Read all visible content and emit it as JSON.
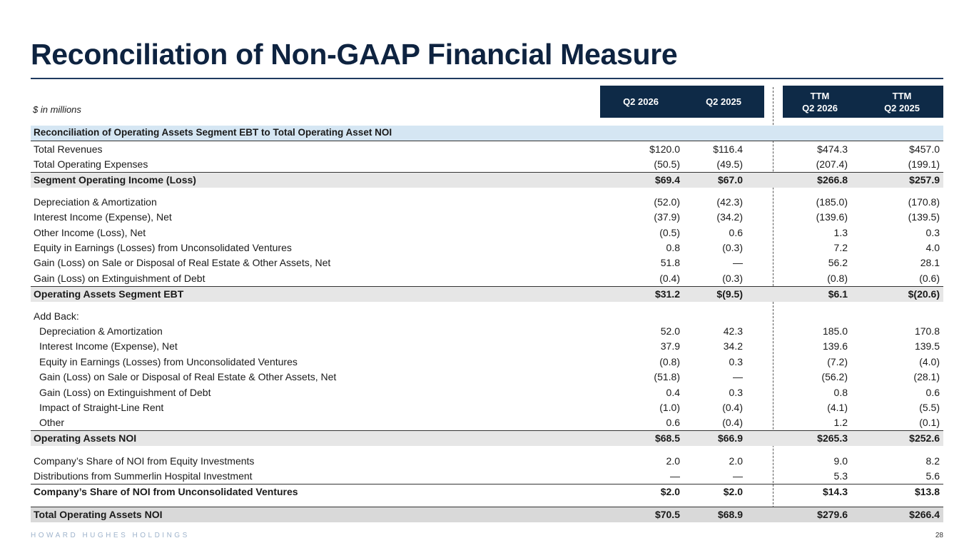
{
  "title": "Reconciliation of Non-GAAP Financial Measure",
  "units_note": "$ in millions",
  "columns": [
    {
      "line1": "Q2 2026",
      "line2": ""
    },
    {
      "line1": "Q2 2025",
      "line2": ""
    },
    {
      "line1": "TTM",
      "line2": "Q2 2026"
    },
    {
      "line1": "TTM",
      "line2": "Q2 2025"
    }
  ],
  "section_header": "Reconciliation of Operating Assets Segment EBT to Total Operating Asset NOI",
  "rows": [
    {
      "label": "Total Revenues",
      "values": [
        "$120.0",
        "$116.4",
        "$474.3",
        "$457.0"
      ]
    },
    {
      "label": "Total Operating Expenses",
      "values": [
        "(50.5)",
        "(49.5)",
        "(207.4)",
        "(199.1)"
      ]
    },
    {
      "label": "Segment Operating Income (Loss)",
      "values": [
        "$69.4",
        "$67.0",
        "$266.8",
        "$257.9"
      ]
    },
    {
      "label": "Depreciation & Amortization",
      "values": [
        "(52.0)",
        "(42.3)",
        "(185.0)",
        "(170.8)"
      ]
    },
    {
      "label": "Interest Income (Expense), Net",
      "values": [
        "(37.9)",
        "(34.2)",
        "(139.6)",
        "(139.5)"
      ]
    },
    {
      "label": "Other Income (Loss), Net",
      "values": [
        "(0.5)",
        "0.6",
        "1.3",
        "0.3"
      ]
    },
    {
      "label": "Equity in Earnings (Losses) from Unconsolidated Ventures",
      "values": [
        "0.8",
        "(0.3)",
        "7.2",
        "4.0"
      ]
    },
    {
      "label": "Gain (Loss) on Sale or Disposal of Real Estate & Other Assets, Net",
      "values": [
        "51.8",
        "—",
        "56.2",
        "28.1"
      ]
    },
    {
      "label": "Gain (Loss) on Extinguishment of Debt",
      "values": [
        "(0.4)",
        "(0.3)",
        "(0.8)",
        "(0.6)"
      ]
    },
    {
      "label": "Operating Assets Segment EBT",
      "values": [
        "$31.2",
        "$(9.5)",
        "$6.1",
        "$(20.6)"
      ]
    },
    {
      "label": "Add Back:",
      "values": [
        "",
        "",
        "",
        ""
      ]
    },
    {
      "label": "Depreciation & Amortization",
      "values": [
        "52.0",
        "42.3",
        "185.0",
        "170.8"
      ]
    },
    {
      "label": "Interest Income (Expense), Net",
      "values": [
        "37.9",
        "34.2",
        "139.6",
        "139.5"
      ]
    },
    {
      "label": "Equity in Earnings (Losses) from Unconsolidated Ventures",
      "values": [
        "(0.8)",
        "0.3",
        "(7.2)",
        "(4.0)"
      ]
    },
    {
      "label": "Gain (Loss) on Sale or Disposal of Real Estate & Other Assets, Net",
      "values": [
        "(51.8)",
        "—",
        "(56.2)",
        "(28.1)"
      ]
    },
    {
      "label": "Gain (Loss) on Extinguishment of Debt",
      "values": [
        "0.4",
        "0.3",
        "0.8",
        "0.6"
      ]
    },
    {
      "label": "Impact of Straight-Line Rent",
      "values": [
        "(1.0)",
        "(0.4)",
        "(4.1)",
        "(5.5)"
      ]
    },
    {
      "label": "Other",
      "values": [
        "0.6",
        "(0.4)",
        "1.2",
        "(0.1)"
      ]
    },
    {
      "label": "Operating Assets NOI",
      "values": [
        "$68.5",
        "$66.9",
        "$265.3",
        "$252.6"
      ]
    },
    {
      "label": "Company’s Share of NOI from Equity Investments",
      "values": [
        "2.0",
        "2.0",
        "9.0",
        "8.2"
      ]
    },
    {
      "label": "Distributions from Summerlin Hospital Investment",
      "values": [
        "—",
        "—",
        "5.3",
        "5.6"
      ]
    },
    {
      "label": "Company’s Share of NOI from Unconsolidated Ventures",
      "values": [
        "$2.0",
        "$2.0",
        "$14.3",
        "$13.8"
      ]
    },
    {
      "label": "Total Operating Assets NOI",
      "values": [
        "$70.5",
        "$68.9",
        "$279.6",
        "$266.4"
      ]
    }
  ],
  "footer": {
    "brand": "HOWARD HUGHES HOLDINGS",
    "page": "28"
  }
}
